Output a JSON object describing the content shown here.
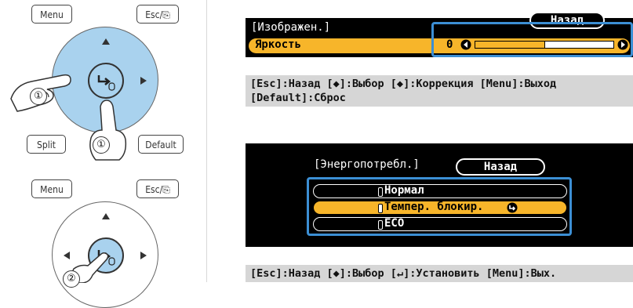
{
  "remote_top": {
    "menu_label": "Menu",
    "esc_label": "Esc/⎘",
    "split_label": "Split",
    "default_label": "Default",
    "step1_left": "①",
    "step1_bottom": "①"
  },
  "remote_bottom": {
    "menu_label": "Menu",
    "esc_label": "Esc/⎘",
    "step2": "②"
  },
  "brightness_menu": {
    "title": "[Изображен.]",
    "back_label": "Назад",
    "item_label": "Яркость",
    "value": "0",
    "slider_fraction": 0.5
  },
  "help_1": {
    "line1": "[Esc]:Назад [◆]:Выбор [◆]:Коррекция [Menu]:Выход",
    "line2": "[Default]:Сброс"
  },
  "power_menu": {
    "title": "[Энергопотребл.]",
    "back_label": "Назад",
    "options": [
      {
        "label": "Нормал",
        "selected": false
      },
      {
        "label": "Темпер. блокир.",
        "selected": true
      },
      {
        "label": "ECO",
        "selected": false
      }
    ]
  },
  "help_2": {
    "line1": "[Esc]:Назад [◆]:Выбор [↵]:Установить [Menu]:Вых."
  },
  "colors": {
    "highlight_orange": "#f7b52a",
    "selection_blue": "#3c8fd4",
    "dpad_blue": "#a9d2ee",
    "help_gray": "#d6d6d6"
  }
}
